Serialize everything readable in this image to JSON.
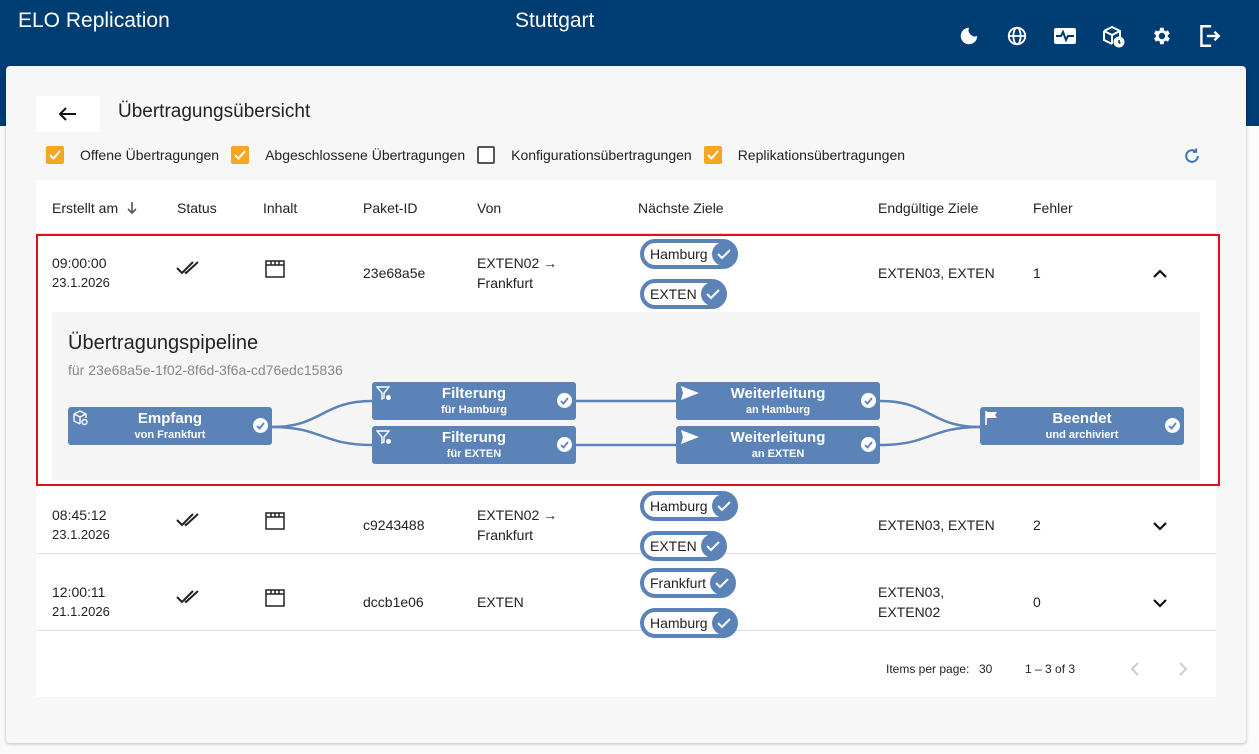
{
  "header": {
    "app_title": "ELO Replication",
    "site": "Stuttgart",
    "icons": [
      "moon-icon",
      "globe-icon",
      "monitor-heart-icon",
      "package-clock-icon",
      "gear-icon",
      "logout-icon"
    ]
  },
  "page": {
    "title": "Übertragungsübersicht"
  },
  "filters": [
    {
      "label": "Offene Übertragungen",
      "checked": true
    },
    {
      "label": "Abgeschlossene Übertragungen",
      "checked": true
    },
    {
      "label": "Konfigurationsübertragungen",
      "checked": false
    },
    {
      "label": "Replikationsübertragungen",
      "checked": true
    }
  ],
  "columns": [
    "Erstellt am",
    "Status",
    "Inhalt",
    "Paket-ID",
    "Von",
    "Nächste Ziele",
    "Endgültige Ziele",
    "Fehler"
  ],
  "rows": [
    {
      "time": "09:00:00",
      "date": "23.1.2026",
      "paket_id": "23e68a5e",
      "von_1": "EXTEN02 →",
      "von_2": "Frankfurt",
      "next": [
        "Hamburg",
        "EXTEN"
      ],
      "final_1": "EXTEN03, EXTEN",
      "final_2": "",
      "errors": "1",
      "expanded": true
    },
    {
      "time": "08:45:12",
      "date": "23.1.2026",
      "paket_id": "c9243488",
      "von_1": "EXTEN02 →",
      "von_2": "Frankfurt",
      "next": [
        "Hamburg",
        "EXTEN"
      ],
      "final_1": "EXTEN03, EXTEN",
      "final_2": "",
      "errors": "2",
      "expanded": false
    },
    {
      "time": "12:00:11",
      "date": "21.1.2026",
      "paket_id": "dccb1e06",
      "von_1": "EXTEN",
      "von_2": "",
      "next": [
        "Frankfurt",
        "Hamburg"
      ],
      "final_1": "EXTEN03,",
      "final_2": "EXTEN02",
      "errors": "0",
      "expanded": false
    }
  ],
  "pipeline": {
    "title": "Übertragungspipeline",
    "subtitle": "für 23e68a5e-1f02-8f6d-3f6a-cd76edc15836",
    "nodes": {
      "empfang": {
        "title": "Empfang",
        "sub": "von Frankfurt"
      },
      "filter_hh": {
        "title": "Filterung",
        "sub": "für Hamburg"
      },
      "filter_ex": {
        "title": "Filterung",
        "sub": "für EXTEN"
      },
      "weiter_hh": {
        "title": "Weiterleitung",
        "sub": "an Hamburg"
      },
      "weiter_ex": {
        "title": "Weiterleitung",
        "sub": "an EXTEN"
      },
      "beendet": {
        "title": "Beendet",
        "sub": "und archiviert"
      }
    }
  },
  "paginator": {
    "items_label": "Items per page:",
    "page_size": "30",
    "range": "1 – 3 of 3"
  },
  "colors": {
    "header": "#003d73",
    "accent": "#5b83b8",
    "checkbox": "#f5a623",
    "highlight": "#e0101a"
  }
}
